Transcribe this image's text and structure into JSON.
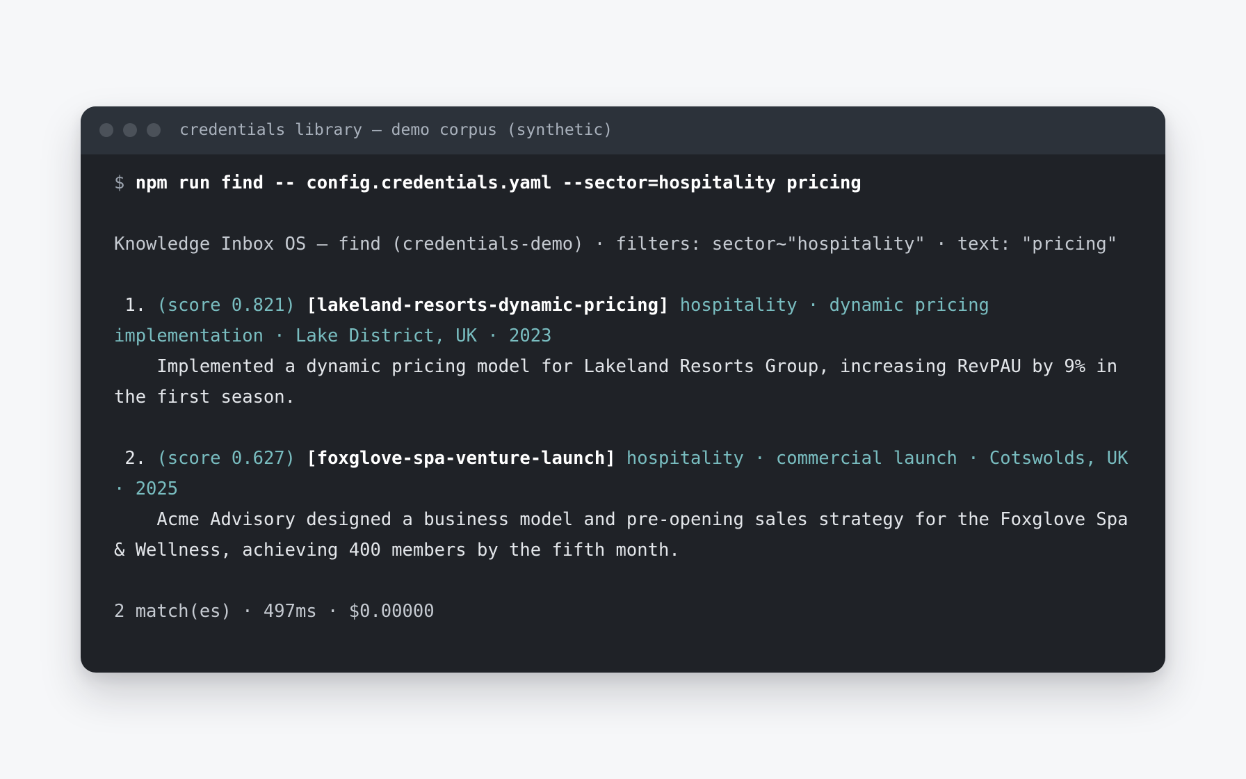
{
  "window": {
    "title": "credentials library — demo corpus (synthetic)"
  },
  "command": {
    "prompt": "$ ",
    "text": "npm run find -- config.credentials.yaml --sector=hospitality pricing"
  },
  "header": {
    "text": "Knowledge Inbox OS — find (credentials-demo) · filters: sector~\"hospitality\" · text: \"pricing\""
  },
  "results": [
    {
      "number": " 1. ",
      "score": "(score 0.821) ",
      "id": "[lakeland-resorts-dynamic-pricing]",
      "meta": " hospitality · dynamic pricing implementation · Lake District, UK · 2023",
      "description": "    Implemented a dynamic pricing model for Lakeland Resorts Group, increasing RevPAU by 9% in the first season."
    },
    {
      "number": " 2. ",
      "score": "(score 0.627) ",
      "id": "[foxglove-spa-venture-launch]",
      "meta": " hospitality · commercial launch · Cotswolds, UK · 2025",
      "description": "    Acme Advisory designed a business model and pre-opening sales strategy for the Foxglove Spa & Wellness, achieving 400 members by the fifth month."
    }
  ],
  "summary": {
    "text": "2 match(es) · 497ms · $0.00000"
  },
  "colors": {
    "page_background": "#f6f7f9",
    "terminal_background": "#1f2227",
    "titlebar_background": "#2c323a",
    "accent_teal": "#79bdc0"
  }
}
